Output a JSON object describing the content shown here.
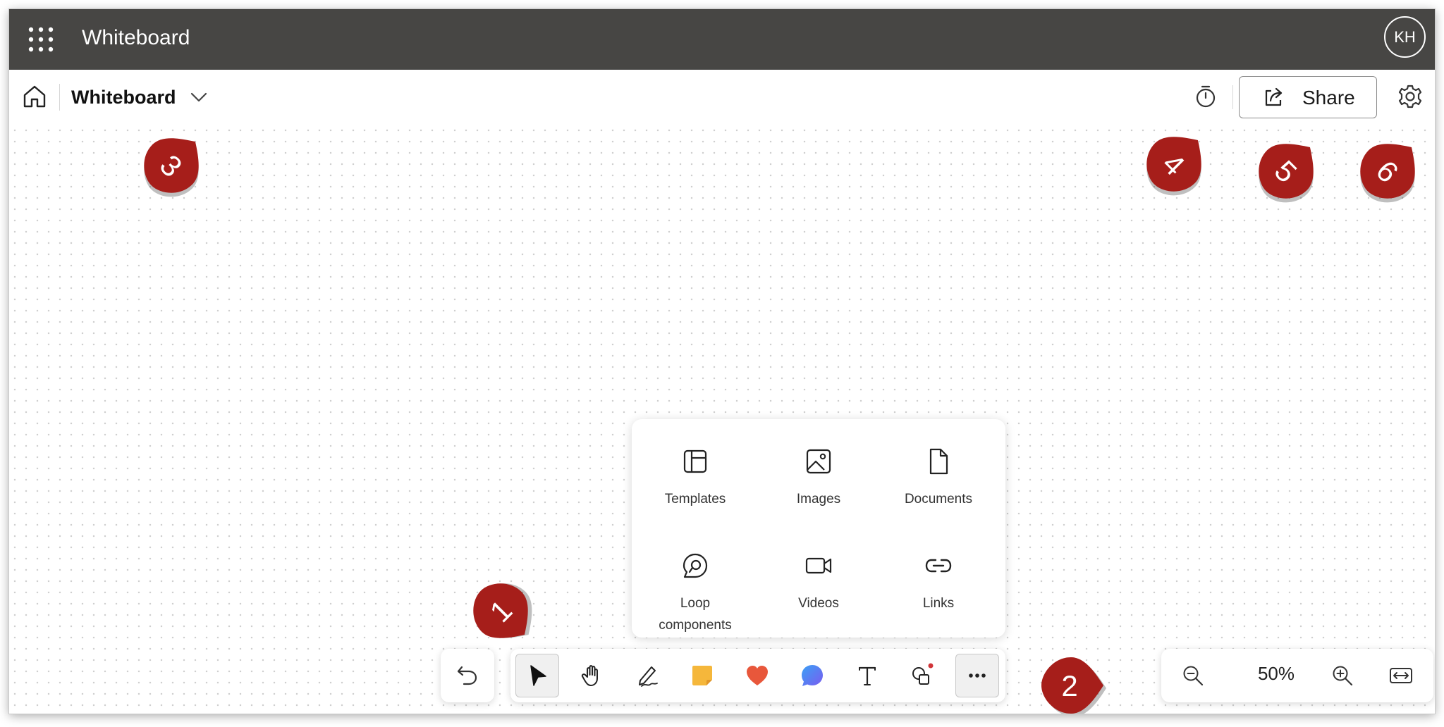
{
  "app": {
    "title": "Whiteboard",
    "user_initials": "KH"
  },
  "commandbar": {
    "board_name": "Whiteboard",
    "share_label": "Share"
  },
  "insert_menu": {
    "items": [
      {
        "label": "Templates",
        "icon": "templates-icon"
      },
      {
        "label": "Images",
        "icon": "image-icon"
      },
      {
        "label": "Documents",
        "icon": "document-icon"
      },
      {
        "label": "Loop\ncomponents",
        "icon": "loop-icon"
      },
      {
        "label": "Videos",
        "icon": "video-icon"
      },
      {
        "label": "Links",
        "icon": "link-icon"
      }
    ]
  },
  "toolbar": {
    "tools": [
      "undo-icon",
      "select-icon",
      "hand-icon",
      "pen-icon",
      "sticky-note-icon",
      "reactions-heart-icon",
      "comment-bubble-icon",
      "text-icon",
      "shapes-icon",
      "more-icon"
    ]
  },
  "zoom": {
    "level": "50%"
  },
  "callouts": [
    "1",
    "2",
    "3",
    "4",
    "5",
    "6"
  ],
  "colors": {
    "titlebar": "#474644",
    "callout": "#a61e1a",
    "sticky_note": "#f5b73b",
    "heart": "#e8573b",
    "bubble": "#4f7ff0",
    "notification_dot": "#d13438"
  }
}
